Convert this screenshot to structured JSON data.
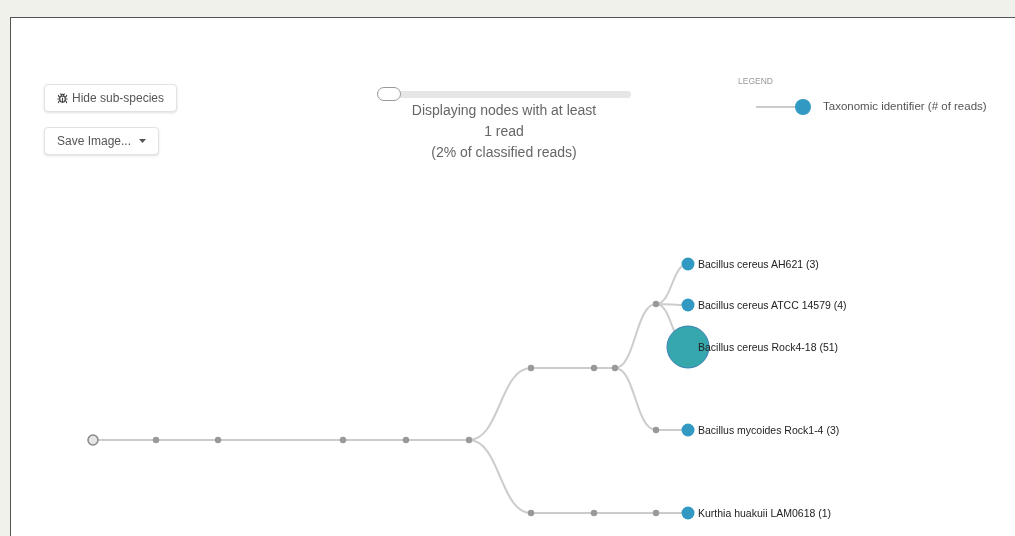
{
  "buttons": [
    {
      "label": "Hide sub-species",
      "kind": "icon"
    },
    {
      "label": "Save Image...",
      "kind": "dropdown"
    }
  ],
  "slider": {
    "level": 0,
    "caption_lines": [
      "Displaying nodes with at least",
      "1 read",
      "(2% of classified reads)"
    ]
  },
  "legend": {
    "title": "LEGEND",
    "item": "Taxonomic identifier (# of reads)"
  },
  "tree": {
    "kind": "root",
    "children": [
      {
        "kind": "internal",
        "children": [
          {
            "kind": "internal",
            "children": [
              {
                "kind": "internal",
                "children": [
                  {
                    "kind": "internal",
                    "children": [
                      {
                        "kind": "internal",
                        "children": [
                          {
                            "kind": "internal",
                            "children": [
                              {
                                "kind": "internal",
                                "children": [
                                  {
                                    "kind": "internal",
                                    "children": [
                                      {
                                        "kind": "internal",
                                        "children": [
                                          {
                                            "kind": "leaf",
                                            "label": "Bacillus cereus AH621 (3)"
                                          },
                                          {
                                            "kind": "leaf",
                                            "label": "Bacillus cereus ATCC 14579 (4)"
                                          },
                                          {
                                            "kind": "major_leaf",
                                            "label": "Bacillus cereus Rock4-18 (51)"
                                          }
                                        ]
                                      },
                                      {
                                        "kind": "internal",
                                        "children": [
                                          {
                                            "kind": "leaf",
                                            "label": "Bacillus mycoides Rock1-4 (3)"
                                          }
                                        ]
                                      }
                                    ]
                                  }
                                ]
                              }
                            ]
                          },
                          {
                            "kind": "internal",
                            "children": [
                              {
                                "kind": "internal",
                                "children": [
                                  {
                                    "kind": "internal",
                                    "children": [
                                      {
                                        "kind": "leaf",
                                        "label": "Kurthia huakuii LAM0618 (1)"
                                      }
                                    ]
                                  }
                                ]
                              }
                            ]
                          }
                        ]
                      }
                    ]
                  }
                ]
              }
            ]
          }
        ]
      }
    ]
  }
}
